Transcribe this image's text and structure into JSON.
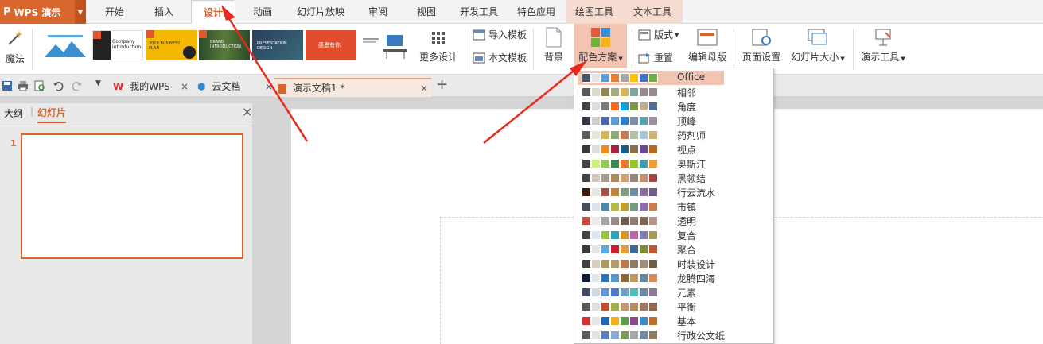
{
  "app": {
    "logo": "P",
    "name": "WPS 演示"
  },
  "tabs": [
    {
      "label": "开始"
    },
    {
      "label": "插入"
    },
    {
      "label": "设计"
    },
    {
      "label": "动画"
    },
    {
      "label": "幻灯片放映"
    },
    {
      "label": "审阅"
    },
    {
      "label": "视图"
    },
    {
      "label": "开发工具"
    },
    {
      "label": "特色应用"
    },
    {
      "label": "绘图工具"
    },
    {
      "label": "文本工具"
    }
  ],
  "ribbon": {
    "magic": "魔法",
    "more_designs": "更多设计",
    "import_template": "导入模板",
    "this_template": "本文模板",
    "background": "背景",
    "color_scheme": "配色方案",
    "layout": "版式",
    "reset": "重置",
    "edit_master": "编辑母版",
    "page_setup": "页面设置",
    "slide_size": "幻灯片大小",
    "presentation_tools": "演示工具",
    "thumbs": [
      {
        "text": ""
      },
      {
        "text": "Company introduction"
      },
      {
        "text": "2018 BUSINESS PLAN"
      },
      {
        "text": "BRAND INTRODUCTION"
      },
      {
        "text": "PRESENTATION DESIGN"
      },
      {
        "text": "感恩有你"
      }
    ]
  },
  "doctabs": [
    {
      "label": "我的WPS"
    },
    {
      "label": "云文档"
    },
    {
      "label": "演示文稿1 *"
    }
  ],
  "leftpanel": {
    "outline": "大纲",
    "slides": "幻灯片",
    "slide_number": "1"
  },
  "schemes": [
    {
      "name": "Office",
      "colors": [
        "#44546a",
        "#e7e6e6",
        "#5b9bd5",
        "#ed7d31",
        "#a5a5a5",
        "#ffc000",
        "#4472c4",
        "#70ad47"
      ]
    },
    {
      "name": "相邻",
      "colors": [
        "#595959",
        "#dddac8",
        "#918655",
        "#a5ab81",
        "#d8b25c",
        "#7ba79d",
        "#968c8c",
        "#968c8c"
      ]
    },
    {
      "name": "角度",
      "colors": [
        "#434342",
        "#dddddd",
        "#797b7e",
        "#f96a1b",
        "#08a1d9",
        "#7c984a",
        "#c2ad8d",
        "#506e94"
      ]
    },
    {
      "name": "顶峰",
      "colors": [
        "#373545",
        "#cecbc8",
        "#4a66ac",
        "#629dd1",
        "#297fd5",
        "#7f8fa9",
        "#5aa2ae",
        "#9d90a0"
      ]
    },
    {
      "name": "药剂师",
      "colors": [
        "#5e5e5e",
        "#e6e6d9",
        "#d4b85c",
        "#8cad78",
        "#cc7a52",
        "#b1c1a1",
        "#a8c7d9",
        "#cbb474"
      ]
    },
    {
      "name": "视点",
      "colors": [
        "#383838",
        "#dedede",
        "#f08c1c",
        "#a7203e",
        "#1b5c84",
        "#8a7048",
        "#6e4897",
        "#b16b23"
      ]
    },
    {
      "name": "奥斯汀",
      "colors": [
        "#454545",
        "#caf278",
        "#94c954",
        "#3e8853",
        "#ec7a28",
        "#98c723",
        "#3ea0b0",
        "#f19b35"
      ]
    },
    {
      "name": "黑领结",
      "colors": [
        "#454545",
        "#d1cac0",
        "#a69b8f",
        "#b08a5f",
        "#d2a171",
        "#9a8677",
        "#c28e75",
        "#a34b4b"
      ]
    },
    {
      "name": "行云流水",
      "colors": [
        "#3d1a0c",
        "#e7e6df",
        "#a44e47",
        "#c0853c",
        "#7e9e7f",
        "#6c8ea4",
        "#8f6a9e",
        "#6e5c8f"
      ]
    },
    {
      "name": "市镇",
      "colors": [
        "#444d5a",
        "#dce2e9",
        "#4a89aa",
        "#b8b848",
        "#c0a029",
        "#769a7c",
        "#8e6cb0",
        "#c87d53"
      ]
    },
    {
      "name": "透明",
      "colors": [
        "#c94c3a",
        "#eaeaea",
        "#a5a5a5",
        "#9a8a8a",
        "#6f5b4a",
        "#8f7c73",
        "#7e6452",
        "#b5958a"
      ]
    },
    {
      "name": "复合",
      "colors": [
        "#454545",
        "#d8e6f0",
        "#98c23c",
        "#2fa3ba",
        "#d49626",
        "#c066a8",
        "#7e7eb8",
        "#a89c5c"
      ]
    },
    {
      "name": "聚合",
      "colors": [
        "#3a3a3a",
        "#dfe5e8",
        "#5aa8df",
        "#d01a2e",
        "#e79c3a",
        "#3d6a94",
        "#7b8d3a",
        "#bb5a3a"
      ]
    },
    {
      "name": "时装设计",
      "colors": [
        "#404040",
        "#d8cebf",
        "#a99860",
        "#b59b6a",
        "#c27846",
        "#8e7964",
        "#a28c75",
        "#6e5f42"
      ]
    },
    {
      "name": "龙腾四海",
      "colors": [
        "#0f1f3a",
        "#e3e6ea",
        "#2f72b5",
        "#5a96c8",
        "#8a6b3a",
        "#c49a5a",
        "#6a8aa0",
        "#d88a5a"
      ]
    },
    {
      "name": "元素",
      "colors": [
        "#3c4a67",
        "#cfd9e6",
        "#6094d6",
        "#4a7bd0",
        "#69a3c5",
        "#4abfbe",
        "#6a8aa8",
        "#8c7a9a"
      ]
    },
    {
      "name": "平衡",
      "colors": [
        "#595959",
        "#e0e0dc",
        "#c14f2d",
        "#a3b04e",
        "#c19b6b",
        "#b88d5a",
        "#a3785c",
        "#926649"
      ]
    },
    {
      "name": "基本",
      "colors": [
        "#d63131",
        "#e6e6e6",
        "#2067b5",
        "#f2b21a",
        "#5c9c4c",
        "#8c4a8c",
        "#3c8ac8",
        "#bf6c28"
      ]
    },
    {
      "name": "行政公文纸",
      "colors": [
        "#595959",
        "#e2e2e2",
        "#5a7fb5",
        "#8aa8d8",
        "#7a9a5a",
        "#a8a8a8",
        "#6c8aa0",
        "#8c7a5a"
      ]
    }
  ]
}
